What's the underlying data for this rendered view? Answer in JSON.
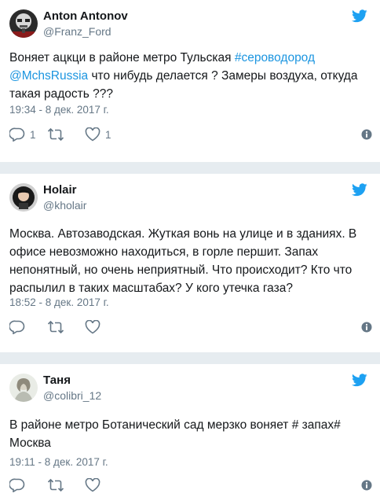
{
  "tweets": [
    {
      "name": "Anton Antonov",
      "handle": "@Franz_Ford",
      "text_parts": [
        "Воняет ацкци в районе метро Тульская ",
        "#сероводород",
        "@MchsRussia",
        " что нибудь делается ? Замеры воздуха, откуда такая радость ???"
      ],
      "time": "19:34 - 8 дек. 2017 г.",
      "replies": "1",
      "retweets": "",
      "likes": "1"
    },
    {
      "name": "Holair",
      "handle": "@kholair",
      "text": "Москва. Автозаводская. Жуткая вонь на улице и в зданиях. В офисе невозможно находиться, в горле першит. Запах непонятный, но очень неприятный. Что происходит? Кто что распылил в таких масштабах? У кого утечка газа?",
      "time": "18:52 - 8 дек. 2017 г.",
      "replies": "",
      "retweets": "",
      "likes": ""
    },
    {
      "name": "Таня",
      "handle": "@colibri_12",
      "text": "В районе метро Ботанический сад мерзко воняет # запах# Москва",
      "time": "19:11 - 8 дек. 2017 г.",
      "replies": "",
      "retweets": "",
      "likes": ""
    }
  ],
  "icons": {
    "brand": "twitter-bird-icon",
    "reply": "reply-icon",
    "retweet": "retweet-icon",
    "like": "heart-icon",
    "info": "info-icon"
  },
  "colors": {
    "twitter_blue": "#1da1f2",
    "link": "#1b95e0",
    "muted": "#657786",
    "background": "#e6ecf0",
    "card": "#ffffff"
  }
}
